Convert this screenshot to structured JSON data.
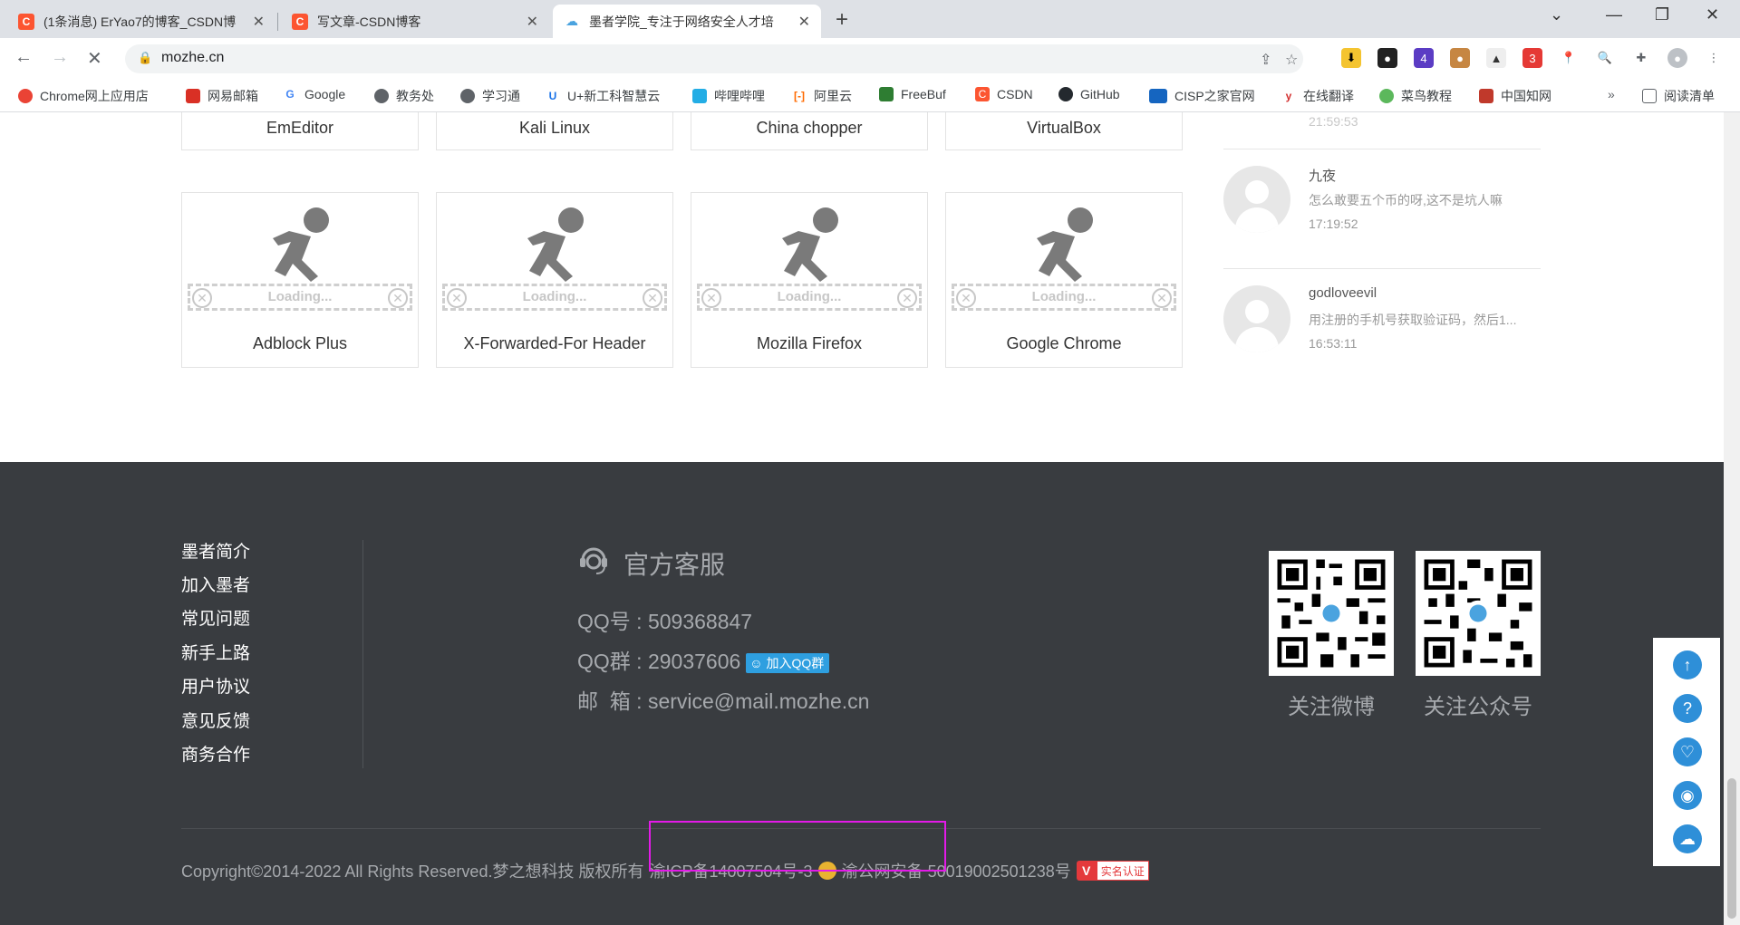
{
  "browser": {
    "tabs": [
      {
        "title": "(1条消息) ErYao7的博客_CSDN博",
        "icon": "csdn-icon"
      },
      {
        "title": "写文章-CSDN博客",
        "icon": "csdn-icon"
      },
      {
        "title": "墨者学院_专注于网络安全人才培",
        "icon": "mozhe-icon"
      }
    ],
    "url": "mozhe.cn",
    "bookmarks": [
      "Chrome网上应用店",
      "网易邮箱",
      "Google",
      "教务处",
      "学习通",
      "U+新工科智慧云",
      "哔哩哔哩",
      "阿里云",
      "FreeBuf",
      "CSDN",
      "GitHub",
      "CISP之家官网",
      "在线翻译",
      "菜鸟教程",
      "中国知网"
    ],
    "reading_list": "阅读清单",
    "extension_badges": {
      "a": "4",
      "b": "3"
    }
  },
  "tools": {
    "top_row": [
      "EmEditor",
      "Kali Linux",
      "China chopper",
      "VirtualBox"
    ],
    "cards": [
      {
        "name": "Adblock Plus",
        "loading": "Loading..."
      },
      {
        "name": "X-Forwarded-For Header",
        "loading": "Loading..."
      },
      {
        "name": "Mozilla Firefox",
        "loading": "Loading..."
      },
      {
        "name": "Google Chrome",
        "loading": "Loading..."
      }
    ]
  },
  "comments": {
    "partial_time": "21:59:53",
    "items": [
      {
        "user": "九夜",
        "text": "怎么敢要五个币的呀,这不是坑人嘛",
        "time": "17:19:52"
      },
      {
        "user": "godloveevil",
        "text": "用注册的手机号获取验证码，然后1...",
        "time": "16:53:11"
      }
    ]
  },
  "footer": {
    "links": [
      "墨者简介",
      "加入墨者",
      "常见问题",
      "新手上路",
      "用户协议",
      "意见反馈",
      "商务合作"
    ],
    "service_title": "官方客服",
    "qq": "QQ号 : 509368847",
    "qq_group": "QQ群 : 29037606",
    "qq_group_button": "加入QQ群",
    "email": "邮  箱 : service@mail.mozhe.cn",
    "qr_weibo": "关注微博",
    "qr_wechat": "关注公众号",
    "copyright_a": "Copyright©2014-2022 All Rights Reserved.梦之想科技 版权所有",
    "icp": "渝ICP备14007504号-3",
    "police": "渝公网安备 50019002501238号",
    "verify_text": "实名认证"
  }
}
